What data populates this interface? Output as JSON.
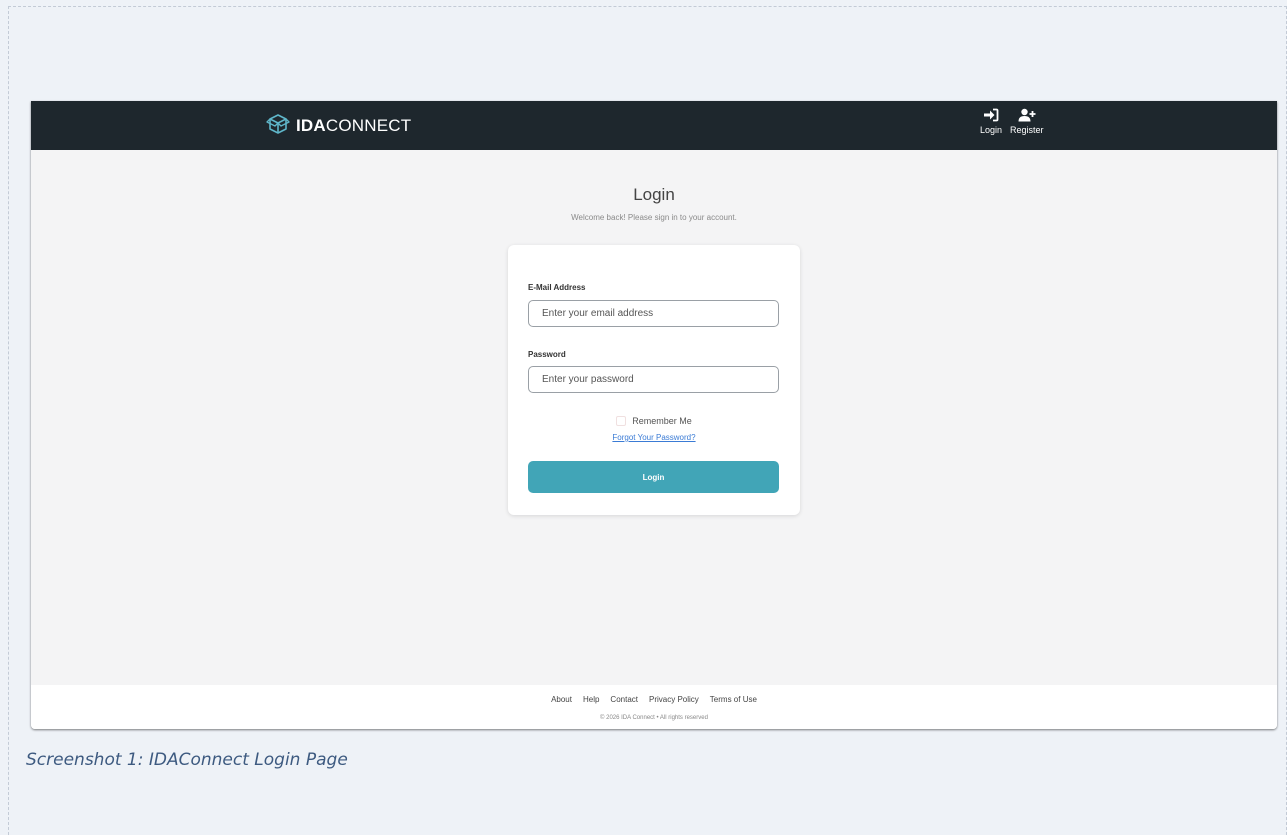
{
  "navbar": {
    "brand_bold": "IDA",
    "brand_rest": "CONNECT",
    "links": [
      {
        "label": "Login",
        "icon": "sign-in-icon"
      },
      {
        "label": "Register",
        "icon": "user-plus-icon"
      }
    ]
  },
  "page": {
    "title": "Login",
    "subtitle": "Welcome back! Please sign in to your account."
  },
  "form": {
    "email_label": "E-Mail Address",
    "email_placeholder": "Enter your email address",
    "password_label": "Password",
    "password_placeholder": "Enter your password",
    "remember_label": "Remember Me",
    "forgot_link": "Forgot Your Password?",
    "submit_label": "Login"
  },
  "footer": {
    "links": [
      "About",
      "Help",
      "Contact",
      "Privacy Policy",
      "Terms of Use"
    ],
    "copyright": "© 2026 IDA Connect • All rights reserved"
  },
  "caption": "Screenshot 1: IDAConnect Login Page",
  "colors": {
    "navbar": "#1e272d",
    "accent": "#41a5b7",
    "link": "#3a7bd5",
    "caption": "#3d5a80",
    "logo_icon": "#5fb6c9"
  }
}
